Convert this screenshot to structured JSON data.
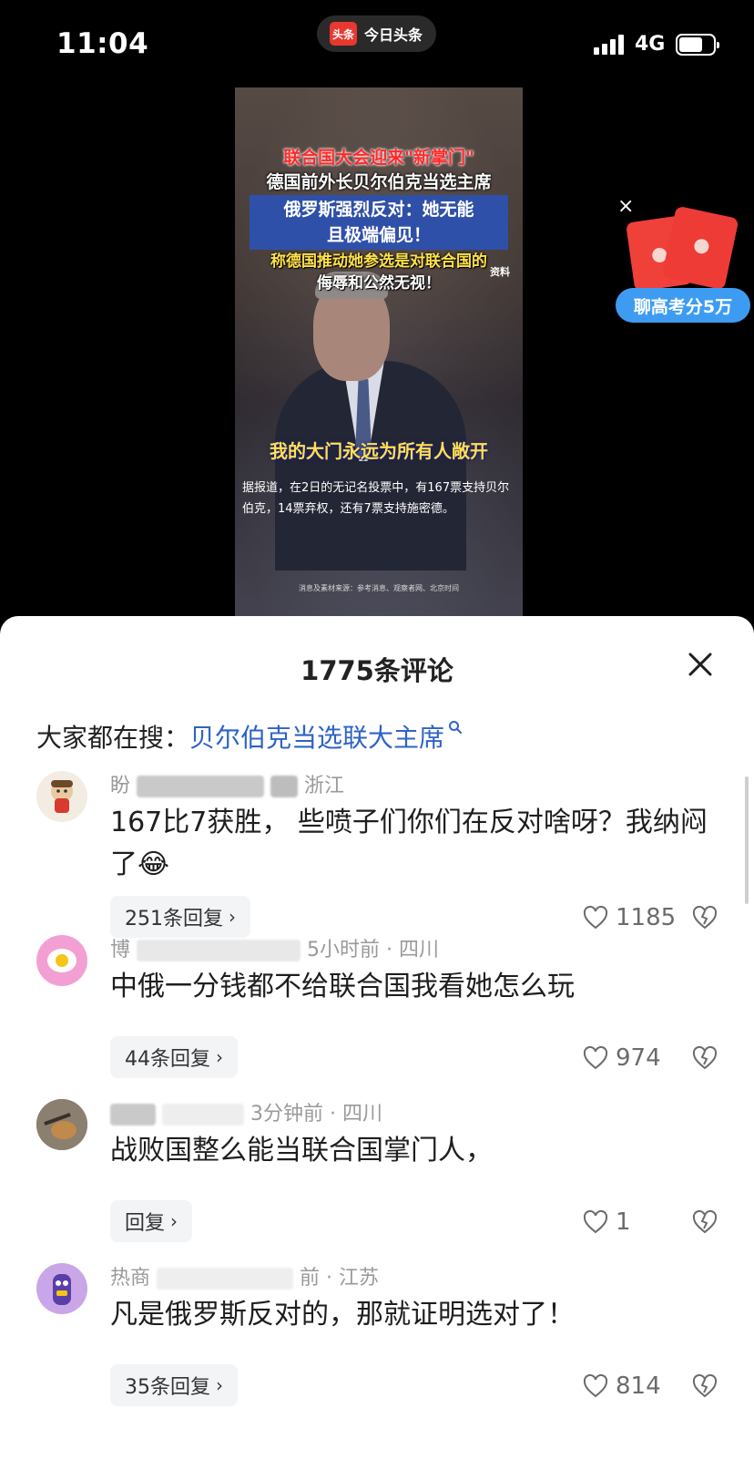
{
  "status_bar": {
    "time": "11:04",
    "app_pill_logo": "头条",
    "app_pill_label": "今日头条",
    "network": "4G",
    "battery_level": 0.7
  },
  "video": {
    "title_line1": "联合国大会迎来\"新掌门\"",
    "title_line2": "德国前外长贝尔伯克当选主席",
    "box_line1": "俄罗斯强烈反对：她无能",
    "box_line2": "且极端偏见！",
    "yellow_line": "称德国推动她参选是对联合国的",
    "white_line": "侮辱和公然无视！",
    "tag": "资料",
    "quote": "我的大门永远为所有人敞开",
    "caption": "据报道，在2日的无记名投票中，有167票支持贝尔伯克，14票弃权，还有7票支持施密德。",
    "source": "消息及素材来源：参考消息、观察者网、北京时间"
  },
  "promo": {
    "label": "聊高考分5万",
    "close_glyph": "×"
  },
  "comments_panel": {
    "title": "1775条评论",
    "search_prefix": "大家都在搜：",
    "search_link": "贝尔伯克当选联大主席",
    "comments": [
      {
        "name_visible": "盼",
        "meta_suffix": "浙江",
        "text": "167比7获胜，   些喷子们你们在反对啥呀？我纳闷了",
        "emoji": "😂",
        "reply_label": "251条回复",
        "likes": "1185"
      },
      {
        "name_visible": "博",
        "meta_suffix": "5小时前 · 四川",
        "text": "中俄一分钱都不给联合国我看她怎么玩",
        "reply_label": "44条回复",
        "likes": "974"
      },
      {
        "name_visible": "",
        "meta_suffix": "3分钟前 · 四川",
        "text": "战败国整么能当联合国掌门人，",
        "reply_label": "回复",
        "likes": "1"
      },
      {
        "name_visible": "热商",
        "meta_suffix": "前 · 江苏",
        "text": "凡是俄罗斯反对的，那就证明选对了！",
        "reply_label": "35条回复",
        "likes": "814"
      }
    ]
  },
  "icons": {
    "close": "close-icon",
    "search": "search-icon",
    "like": "heart-icon",
    "dislike": "broken-heart-icon",
    "chevron": "chevron-right-icon"
  }
}
